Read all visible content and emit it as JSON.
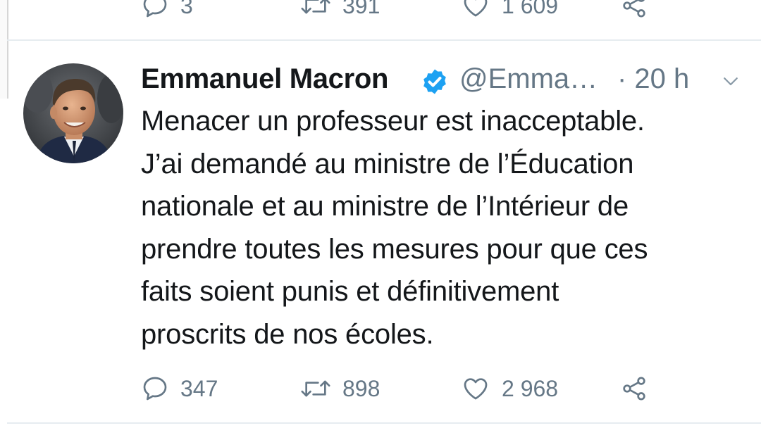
{
  "previous_tweet": {
    "reply_count": "3",
    "retweet_count": "391",
    "like_count": "1 609"
  },
  "tweet": {
    "author_name": "Emmanuel Macron",
    "handle": "@Emma…",
    "time": "· 20 h",
    "text_lines": [
      "Menacer un professeur est inacceptable.",
      "J’ai demandé au ministre de l’Éducation",
      "nationale et au ministre de l’Intérieur de",
      "prendre toutes les mesures pour que ces",
      "faits soient punis et définitivement",
      "proscrits de nos écoles."
    ],
    "reply_count": "347",
    "retweet_count": "898",
    "like_count": "2 968"
  },
  "colors": {
    "accent": "#1da1f2",
    "text": "#14171a",
    "secondary": "#657786",
    "divider": "#e6ecf0"
  },
  "icons": {
    "reply": "speech-bubble-icon",
    "retweet": "retweet-arrows-icon",
    "like": "heart-icon",
    "share": "share-nodes-icon",
    "verified": "verified-badge-icon",
    "menu": "chevron-down-icon"
  }
}
